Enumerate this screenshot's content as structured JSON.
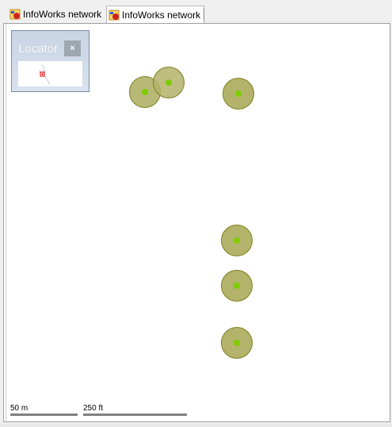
{
  "tabs": [
    {
      "label": "InfoWorks network",
      "icon": "network-icon"
    },
    {
      "label": "InfoWorks network",
      "icon": "network-icon",
      "active": true
    }
  ],
  "locator": {
    "title": "Locator",
    "close_label": "×"
  },
  "scale_bars": [
    {
      "label": "50 m"
    },
    {
      "label": "250 ft"
    }
  ],
  "colors": {
    "node_fill": "#b3b36b",
    "node_stroke": "#7f7f20",
    "node_center": "#7fcc00"
  }
}
